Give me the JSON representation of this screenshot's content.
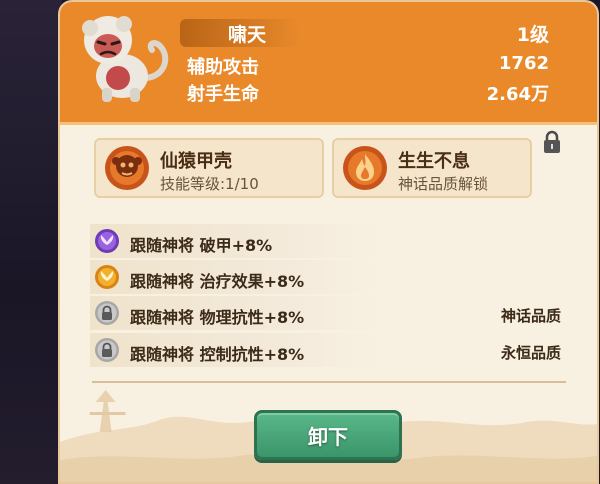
{
  "hero": {
    "name": "啸天",
    "level": "1级",
    "stats": [
      {
        "label": "辅助攻击",
        "value": "1762"
      },
      {
        "label": "射手生命",
        "value": "2.64万"
      }
    ]
  },
  "skills": [
    {
      "title": "仙猿甲壳",
      "subtitle": "技能等级:1/10",
      "icon": "monkey-face-icon",
      "locked": false
    },
    {
      "title": "生生不息",
      "subtitle": "神话品质解锁",
      "icon": "flame-icon",
      "locked": true
    }
  ],
  "bonuses": [
    {
      "text": "跟随神将 破甲+8%",
      "icon": "purple-wings-icon",
      "requirement": ""
    },
    {
      "text": "跟随神将 治疗效果+8%",
      "icon": "gold-wings-icon",
      "requirement": ""
    },
    {
      "text": "跟随神将 物理抗性+8%",
      "icon": "lock-icon",
      "requirement": "神话品质"
    },
    {
      "text": "跟随神将 控制抗性+8%",
      "icon": "lock-icon",
      "requirement": "永恒品质"
    }
  ],
  "actions": {
    "unequip_label": "卸下"
  },
  "colors": {
    "header_orange": "#e9892a",
    "panel_cream": "#f8f1e2",
    "button_green": "#3b956a",
    "text_brown": "#3c2a18"
  }
}
